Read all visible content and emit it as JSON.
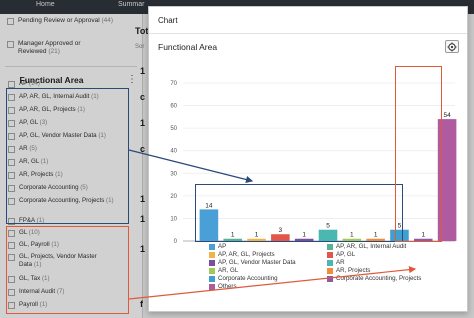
{
  "topbar": {
    "tabs": [
      "Home",
      "Summar"
    ]
  },
  "left_panel": {
    "top_items": [
      {
        "label": "Pending Review or Approval",
        "count": "(44)"
      },
      {
        "label": "Manager Approved or Reviewed",
        "count": "(21)"
      }
    ],
    "section_title": "Functional Area",
    "facets": [
      {
        "label": "AP",
        "count": "(14)"
      },
      {
        "label": "AP, AR, GL, Internal Audit",
        "count": "(1)"
      },
      {
        "label": "AP, AR, GL, Projects",
        "count": "(1)"
      },
      {
        "label": "AP, GL",
        "count": "(3)"
      },
      {
        "label": "AP, GL, Vendor Master Data",
        "count": "(1)"
      },
      {
        "label": "AR",
        "count": "(5)"
      },
      {
        "label": "AR, GL",
        "count": "(1)"
      },
      {
        "label": "AR, Projects",
        "count": "(1)"
      },
      {
        "label": "Corporate Accounting",
        "count": "(5)"
      },
      {
        "label": "Corporate Accounting, Projects",
        "count": "(1)"
      },
      {
        "label": "FP&A",
        "count": "(1)"
      },
      {
        "label": "GL",
        "count": "(10)"
      },
      {
        "label": "GL, Payroll",
        "count": "(1)"
      },
      {
        "label": "GL, Projects, Vendor Master Data",
        "count": "(1)"
      },
      {
        "label": "GL, Tax",
        "count": "(1)"
      },
      {
        "label": "Internal Audit",
        "count": "(7)"
      },
      {
        "label": "Payroll",
        "count": "(1)"
      }
    ]
  },
  "background": {
    "title_peek": "Tot",
    "sort_peek": "Sor",
    "row_marks": [
      "1",
      "c",
      "1",
      "c",
      "1",
      "1",
      "1",
      "f"
    ]
  },
  "dialog": {
    "title": "Chart",
    "region_title": "Functional Area",
    "settings_icon": "chart-settings-icon"
  },
  "chart_data": {
    "type": "bar",
    "categories": [
      "AP",
      "AP, AR, GL, Internal Audit",
      "AP, AR, GL, Projects",
      "AP, GL",
      "AP, GL, Vendor Master Data",
      "AR",
      "AR, GL",
      "AR, Projects",
      "Corporate Accounting",
      "Corporate Accounting, Projects",
      "Others"
    ],
    "values": [
      14,
      1,
      1,
      3,
      1,
      5,
      1,
      1,
      5,
      1,
      54
    ],
    "colors": [
      "#4aa0d6",
      "#5bb09a",
      "#f0b54a",
      "#e2574c",
      "#7a4f9e",
      "#4ab7b0",
      "#a3c95a",
      "#f28c3a",
      "#3fa0d0",
      "#8a5ca8",
      "#b05aa0"
    ],
    "ylim": [
      0,
      70
    ],
    "yticks": [
      0,
      10,
      20,
      30,
      40,
      50,
      60,
      70
    ],
    "data_labels": [
      "14",
      "1",
      "1",
      "3",
      "1",
      "5",
      "1",
      "1",
      "5",
      "1",
      "54"
    ],
    "legend_position": "bottom",
    "grid": true
  },
  "annotation_colors": {
    "blue": "#2a4a7a",
    "red": "#e05a3a"
  }
}
